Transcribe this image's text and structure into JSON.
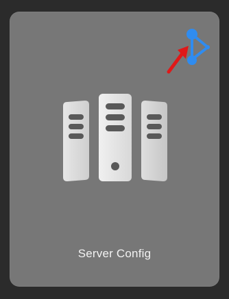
{
  "tile": {
    "label": "Server Config",
    "main_icon": "server-rack-icon",
    "badge_icon": "network-share-icon",
    "pointer_icon": "red-arrow-icon"
  },
  "colors": {
    "background": "#2b2b2b",
    "card": "#777777",
    "label": "#f2f2f2",
    "badge": "#2f8cf0",
    "arrow": "#e01818"
  }
}
